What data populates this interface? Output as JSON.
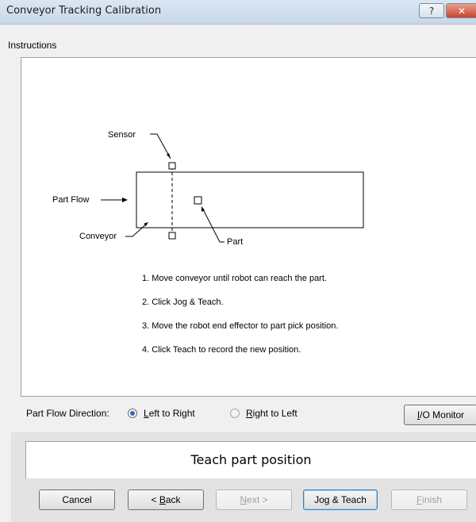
{
  "window": {
    "title": "Conveyor Tracking Calibration",
    "help_button": "?",
    "close_button": "✕"
  },
  "instructions": {
    "group_label": "Instructions",
    "diagram": {
      "sensor_label": "Sensor",
      "part_flow_label": "Part Flow",
      "conveyor_label": "Conveyor",
      "part_label": "Part"
    },
    "steps": [
      "1. Move conveyor until robot can reach the part.",
      "2. Click Jog & Teach.",
      "3. Move the robot end effector to part pick position.",
      "4. Click Teach to record the new position."
    ]
  },
  "flow_direction": {
    "label": "Part Flow Direction:",
    "left_to_right": {
      "mnemonic": "L",
      "rest": "eft to Right",
      "selected": true
    },
    "right_to_left": {
      "mnemonic": "R",
      "rest": "ight to Left",
      "selected": false
    }
  },
  "io_monitor_button": {
    "mnemonic": "I",
    "rest": "/O Monitor"
  },
  "step_panel": {
    "title": "Teach part position"
  },
  "buttons": {
    "cancel": "Cancel",
    "back": {
      "prefix": "< ",
      "mnemonic": "B",
      "rest": "ack"
    },
    "next": {
      "mnemonic": "N",
      "rest": "ext >"
    },
    "jog_teach": "Jog & Teach",
    "finish": {
      "mnemonic": "F",
      "rest": "inish"
    }
  }
}
